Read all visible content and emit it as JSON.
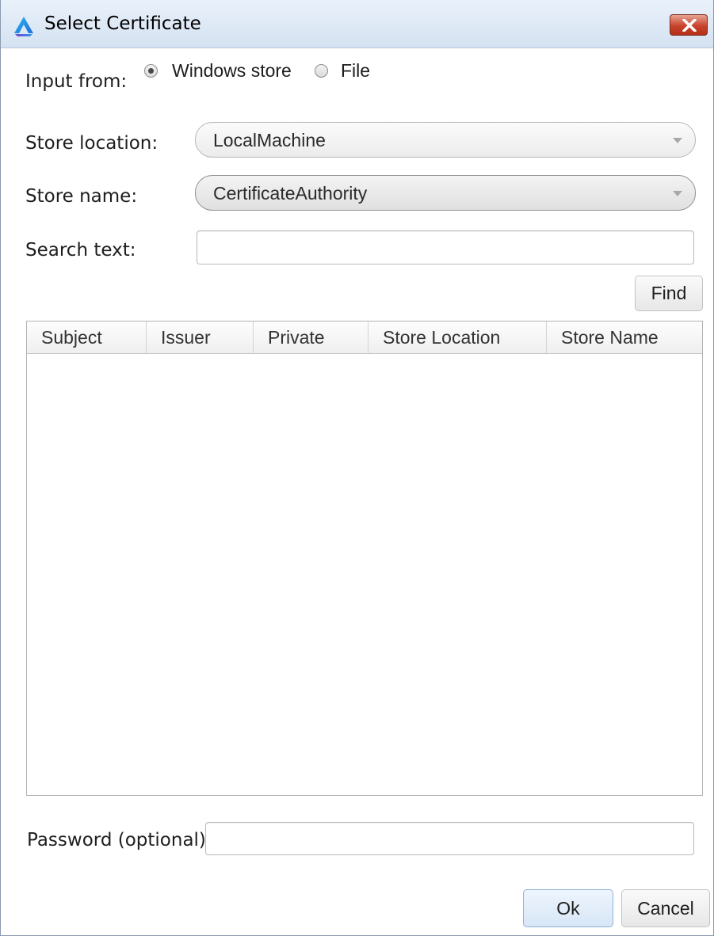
{
  "window": {
    "title": "Select Certificate"
  },
  "form": {
    "input_from_label": "Input from:",
    "radio_windows_store_label": "Windows store",
    "radio_file_label": "File",
    "radio_selected": "Windows store",
    "store_location_label": "Store location:",
    "store_location_value": "LocalMachine",
    "store_name_label": "Store name:",
    "store_name_value": "CertificateAuthority",
    "search_text_label": "Search text:",
    "search_text_value": "",
    "find_label": "Find"
  },
  "table": {
    "columns": [
      "Subject",
      "Issuer",
      "Private",
      "Store Location",
      "Store Name"
    ],
    "rows": []
  },
  "footer": {
    "password_label": "Password (optional):",
    "password_value": "",
    "ok_label": "Ok",
    "cancel_label": "Cancel"
  },
  "icons": {
    "app": "app-logo-icon",
    "close": "close-icon",
    "dropdown": "chevron-down-icon"
  },
  "colors": {
    "close_button": "#c8432c",
    "titlebar": "#dfe9f5",
    "ok_button": "#d7e6f6"
  }
}
